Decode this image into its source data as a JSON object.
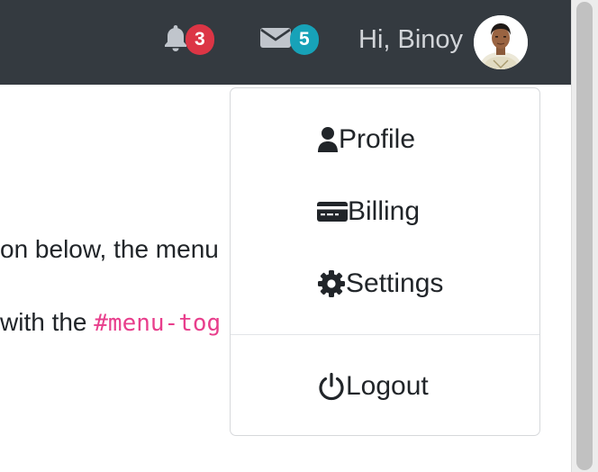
{
  "navbar": {
    "notifications": {
      "icon": "bell-icon",
      "count": "3",
      "badge_color": "#dc3545"
    },
    "messages": {
      "icon": "envelope-icon",
      "count": "5",
      "badge_color": "#17a2b8"
    },
    "greeting": "Hi, Binoy",
    "background": "#343a40"
  },
  "content": {
    "line1": "on below, the menu",
    "line2_prefix": "with the ",
    "line2_code": "#menu-tog"
  },
  "dropdown": {
    "items": [
      {
        "label": "Profile",
        "icon": "user-icon"
      },
      {
        "label": "Billing",
        "icon": "credit-card-icon"
      },
      {
        "label": "Settings",
        "icon": "gear-icon"
      },
      {
        "label": "Logout",
        "icon": "power-icon"
      }
    ]
  }
}
